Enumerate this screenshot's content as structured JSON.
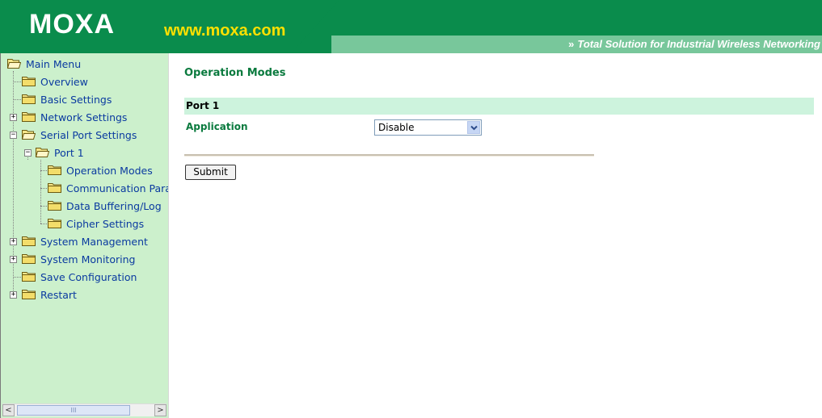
{
  "header": {
    "logo": "MOXA",
    "url": "www.moxa.com",
    "tagline_arrows": "»",
    "tagline": "Total Solution for Industrial Wireless Networking"
  },
  "sidebar": {
    "items": [
      {
        "label": "Main Menu",
        "icon": "open-folder-icon"
      },
      {
        "label": "Overview",
        "icon": "folder-icon"
      },
      {
        "label": "Basic Settings",
        "icon": "folder-icon"
      },
      {
        "label": "Network Settings",
        "icon": "folder-icon",
        "expander": "+"
      },
      {
        "label": "Serial Port Settings",
        "icon": "open-folder-icon",
        "expander": "−"
      },
      {
        "label": "Port 1",
        "icon": "open-folder-icon",
        "expander": "−"
      },
      {
        "label": "Operation Modes",
        "icon": "folder-icon"
      },
      {
        "label": "Communication Para",
        "icon": "folder-icon"
      },
      {
        "label": "Data Buffering/Log",
        "icon": "folder-icon"
      },
      {
        "label": "Cipher Settings",
        "icon": "folder-icon"
      },
      {
        "label": "System Management",
        "icon": "folder-icon",
        "expander": "+"
      },
      {
        "label": "System Monitoring",
        "icon": "folder-icon",
        "expander": "+"
      },
      {
        "label": "Save Configuration",
        "icon": "folder-icon"
      },
      {
        "label": "Restart",
        "icon": "folder-icon",
        "expander": "+"
      }
    ],
    "scroll_left": "<",
    "scroll_right": ">",
    "scroll_grip": "III"
  },
  "main": {
    "title": "Operation Modes",
    "port_title": "Port 1",
    "application_label": "Application",
    "application_value": "Disable",
    "submit_label": "Submit"
  },
  "colors": {
    "header_dark": "#0a8c4c",
    "header_light": "#78c79b",
    "logo_url": "#ffe000",
    "sidebar_bg": "#ccf0cc",
    "link": "#0a3aa0",
    "title_green": "#0a7a3e",
    "port_bar": "#cdf3dd"
  }
}
